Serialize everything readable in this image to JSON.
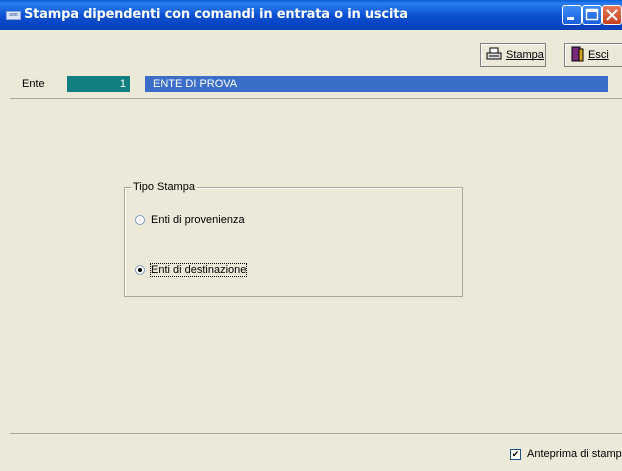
{
  "window": {
    "title": "Stampa dipendenti con comandi in entrata o in uscita",
    "app_icon_text": "ooo"
  },
  "toolbar": {
    "stampa_label": "Stampa",
    "esci_label": "Esci"
  },
  "ente": {
    "label": "Ente",
    "number": "1",
    "name": "ENTE DI PROVA"
  },
  "tipo_stampa": {
    "legend": "Tipo Stampa",
    "options": [
      {
        "label": "Enti di provenienza",
        "selected": false
      },
      {
        "label": "Enti di destinazione",
        "selected": true
      }
    ]
  },
  "status": {
    "anteprima_label": "Anteprima di stampa",
    "anteprima_checked": true
  }
}
